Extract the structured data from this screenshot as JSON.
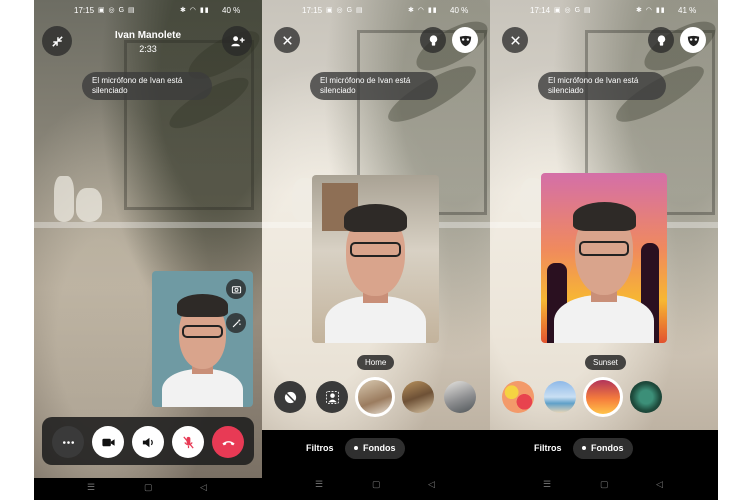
{
  "screens": [
    {
      "status": {
        "time": "17:15",
        "battery": "40 %"
      },
      "caller": {
        "name": "Ivan Manolete",
        "duration": "2:33"
      },
      "toast": {
        "line1": "El micrófono de Ivan está",
        "line2": "silenciado"
      },
      "icons": {
        "top_left": "minimize-icon",
        "top_right": "add-person-icon",
        "thumb_camera": "switch-camera-icon",
        "thumb_effects": "magic-wand-icon",
        "more": "more-icon",
        "video": "video-camera-icon",
        "speaker": "speaker-icon",
        "mic": "mic-off-icon",
        "end": "end-call-icon"
      },
      "colors": {
        "end_call": "#e83a55",
        "control_bar": "#1e1e1e"
      }
    },
    {
      "status": {
        "time": "17:15",
        "battery": "40 %"
      },
      "toast": {
        "line1": "El micrófono de Ivan está",
        "line2": "silenciado"
      },
      "selected_effect_label": "Home",
      "tabs": {
        "filters": "Filtros",
        "backgrounds": "Fondos"
      },
      "icons": {
        "close": "close-icon",
        "lightbulb": "lightbulb-icon",
        "mask": "mask-icon",
        "none": "no-effect-icon",
        "blur": "background-blur-icon"
      },
      "effects": [
        "none",
        "blur",
        "home",
        "bookshelf",
        "room"
      ]
    },
    {
      "status": {
        "time": "17:14",
        "battery": "41 %"
      },
      "toast": {
        "line1": "El micrófono de Ivan está",
        "line2": "silenciado"
      },
      "selected_effect_label": "Sunset",
      "tabs": {
        "filters": "Filtros",
        "backgrounds": "Fondos"
      },
      "icons": {
        "close": "close-icon",
        "lightbulb": "lightbulb-icon",
        "mask": "mask-icon"
      },
      "effects": [
        "pattern",
        "beach",
        "sunset",
        "palm-leaves"
      ]
    }
  ]
}
